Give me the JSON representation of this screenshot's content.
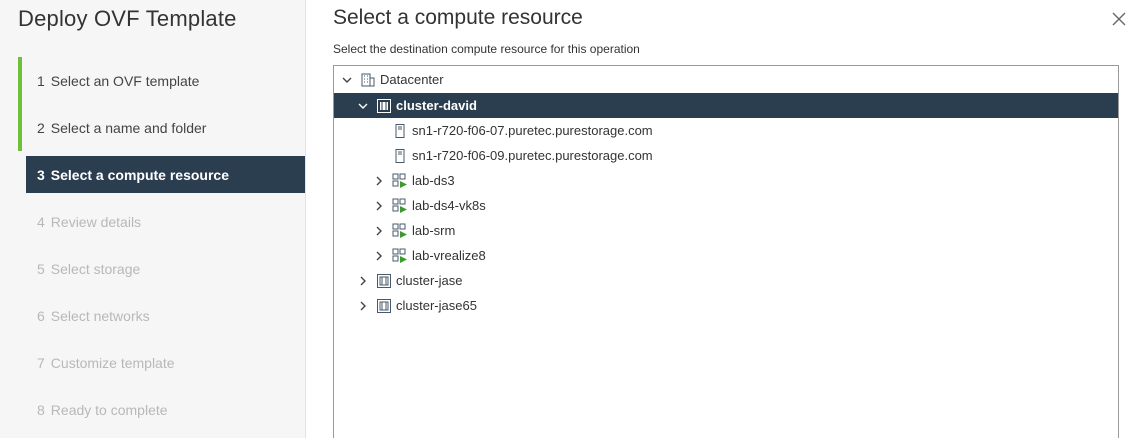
{
  "wizard": {
    "title": "Deploy OVF Template",
    "steps": [
      {
        "num": "1",
        "label": "Select an OVF template",
        "state": "done"
      },
      {
        "num": "2",
        "label": "Select a name and folder",
        "state": "done"
      },
      {
        "num": "3",
        "label": "Select a compute resource",
        "state": "active"
      },
      {
        "num": "4",
        "label": "Review details",
        "state": "disabled"
      },
      {
        "num": "5",
        "label": "Select storage",
        "state": "disabled"
      },
      {
        "num": "6",
        "label": "Select networks",
        "state": "disabled"
      },
      {
        "num": "7",
        "label": "Customize template",
        "state": "disabled"
      },
      {
        "num": "8",
        "label": "Ready to complete",
        "state": "disabled"
      }
    ]
  },
  "main": {
    "title": "Select a compute resource",
    "subtitle": "Select the destination compute resource for this operation",
    "close_icon": "close-icon"
  },
  "tree": {
    "items": [
      {
        "label": "Datacenter",
        "icon": "datacenter-icon",
        "expander": "expanded"
      },
      {
        "label": "cluster-david",
        "icon": "cluster-icon",
        "expander": "expanded",
        "selected": true
      },
      {
        "label": "sn1-r720-f06-07.puretec.purestorage.com",
        "icon": "host-icon",
        "expander": "none"
      },
      {
        "label": "sn1-r720-f06-09.puretec.purestorage.com",
        "icon": "host-icon",
        "expander": "none"
      },
      {
        "label": "lab-ds3",
        "icon": "vapp-icon",
        "expander": "collapsed"
      },
      {
        "label": "lab-ds4-vk8s",
        "icon": "vapp-icon",
        "expander": "collapsed"
      },
      {
        "label": "lab-srm",
        "icon": "vapp-icon",
        "expander": "collapsed"
      },
      {
        "label": "lab-vrealize8",
        "icon": "vapp-icon",
        "expander": "collapsed"
      },
      {
        "label": "cluster-jase",
        "icon": "cluster-icon",
        "expander": "collapsed"
      },
      {
        "label": "cluster-jase65",
        "icon": "cluster-icon",
        "expander": "collapsed"
      }
    ]
  },
  "colors": {
    "accent_dark": "#2b3e50",
    "done_bar": "#6fbf3b",
    "vapp_green": "#3c9a2e"
  }
}
